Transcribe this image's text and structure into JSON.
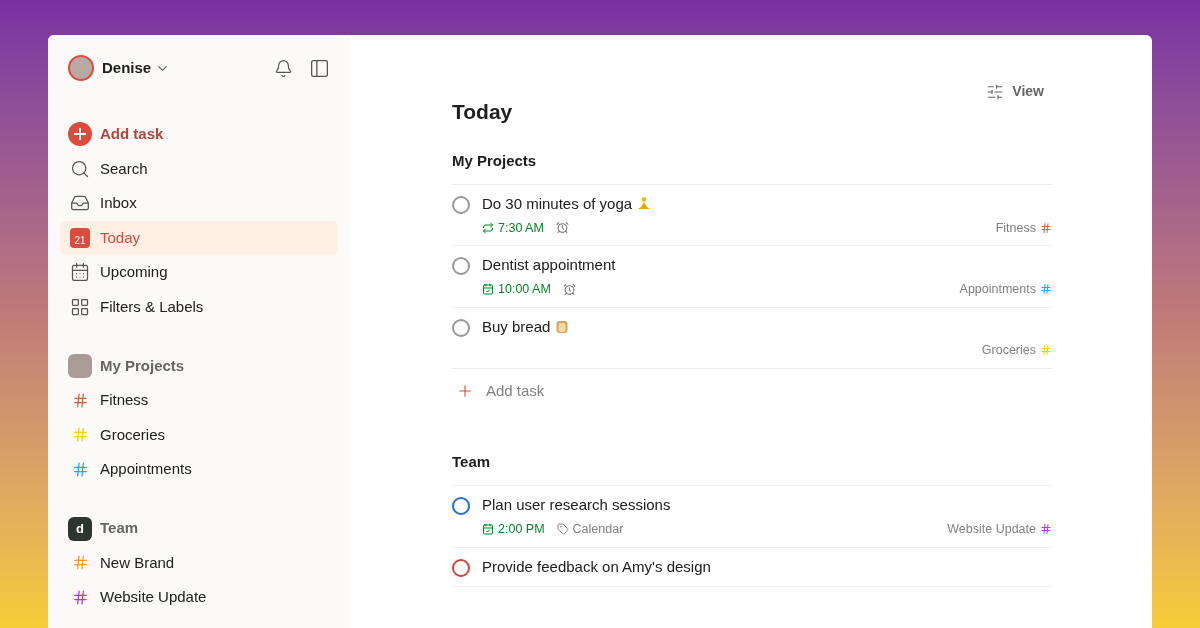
{
  "user": {
    "name": "Denise"
  },
  "nav": [
    {
      "kind": "add",
      "label": "Add task",
      "selected": false
    },
    {
      "kind": "search",
      "label": "Search",
      "selected": false
    },
    {
      "kind": "inbox",
      "label": "Inbox",
      "selected": false
    },
    {
      "kind": "today",
      "label": "Today",
      "selected": true,
      "icon_text": "21"
    },
    {
      "kind": "upcoming",
      "label": "Upcoming",
      "selected": false
    },
    {
      "kind": "filters",
      "label": "Filters & Labels",
      "selected": false
    }
  ],
  "workspaces": [
    {
      "kind": "personal",
      "title": "My Projects",
      "projects": [
        {
          "name": "Fitness",
          "color": "#d1603d"
        },
        {
          "name": "Groceries",
          "color": "#fad000"
        },
        {
          "name": "Appointments",
          "color": "#14aaf5"
        }
      ]
    },
    {
      "kind": "team",
      "title": "Team",
      "logo_letter": "d",
      "projects": [
        {
          "name": "New Brand",
          "color": "#ff9933"
        },
        {
          "name": "Website Update",
          "color": "#af38eb"
        }
      ]
    }
  ],
  "view_button": "View",
  "page_title": "Today",
  "sections": [
    {
      "title": "My Projects",
      "add_label": "Add task",
      "tasks": [
        {
          "title": "Do 30 minutes of yoga",
          "emoji": {
            "kind": "yoga"
          },
          "due": {
            "kind": "recurring",
            "text": "7:30 AM"
          },
          "reminder": true,
          "project": {
            "name": "Fitness",
            "color": "#d1603d"
          },
          "color": "#999999"
        },
        {
          "title": "Dentist appointment",
          "due": {
            "kind": "date",
            "text": "10:00 AM"
          },
          "reminder": true,
          "project": {
            "name": "Appointments",
            "color": "#14aaf5"
          },
          "color": "#999999"
        },
        {
          "title": "Buy bread",
          "emoji": {
            "kind": "bread"
          },
          "project": {
            "name": "Groceries",
            "color": "#fad000"
          },
          "color": "#999999"
        }
      ]
    },
    {
      "title": "Team",
      "tasks": [
        {
          "title": "Plan user research sessions",
          "due": {
            "kind": "date",
            "text": "2:00 PM"
          },
          "reminder": false,
          "label": "Calendar",
          "project": {
            "name": "Website Update",
            "color": "#af38eb"
          },
          "color": "#246fe0"
        },
        {
          "title": "Provide feedback on Amy's design",
          "color": "#d1453b"
        }
      ]
    }
  ]
}
